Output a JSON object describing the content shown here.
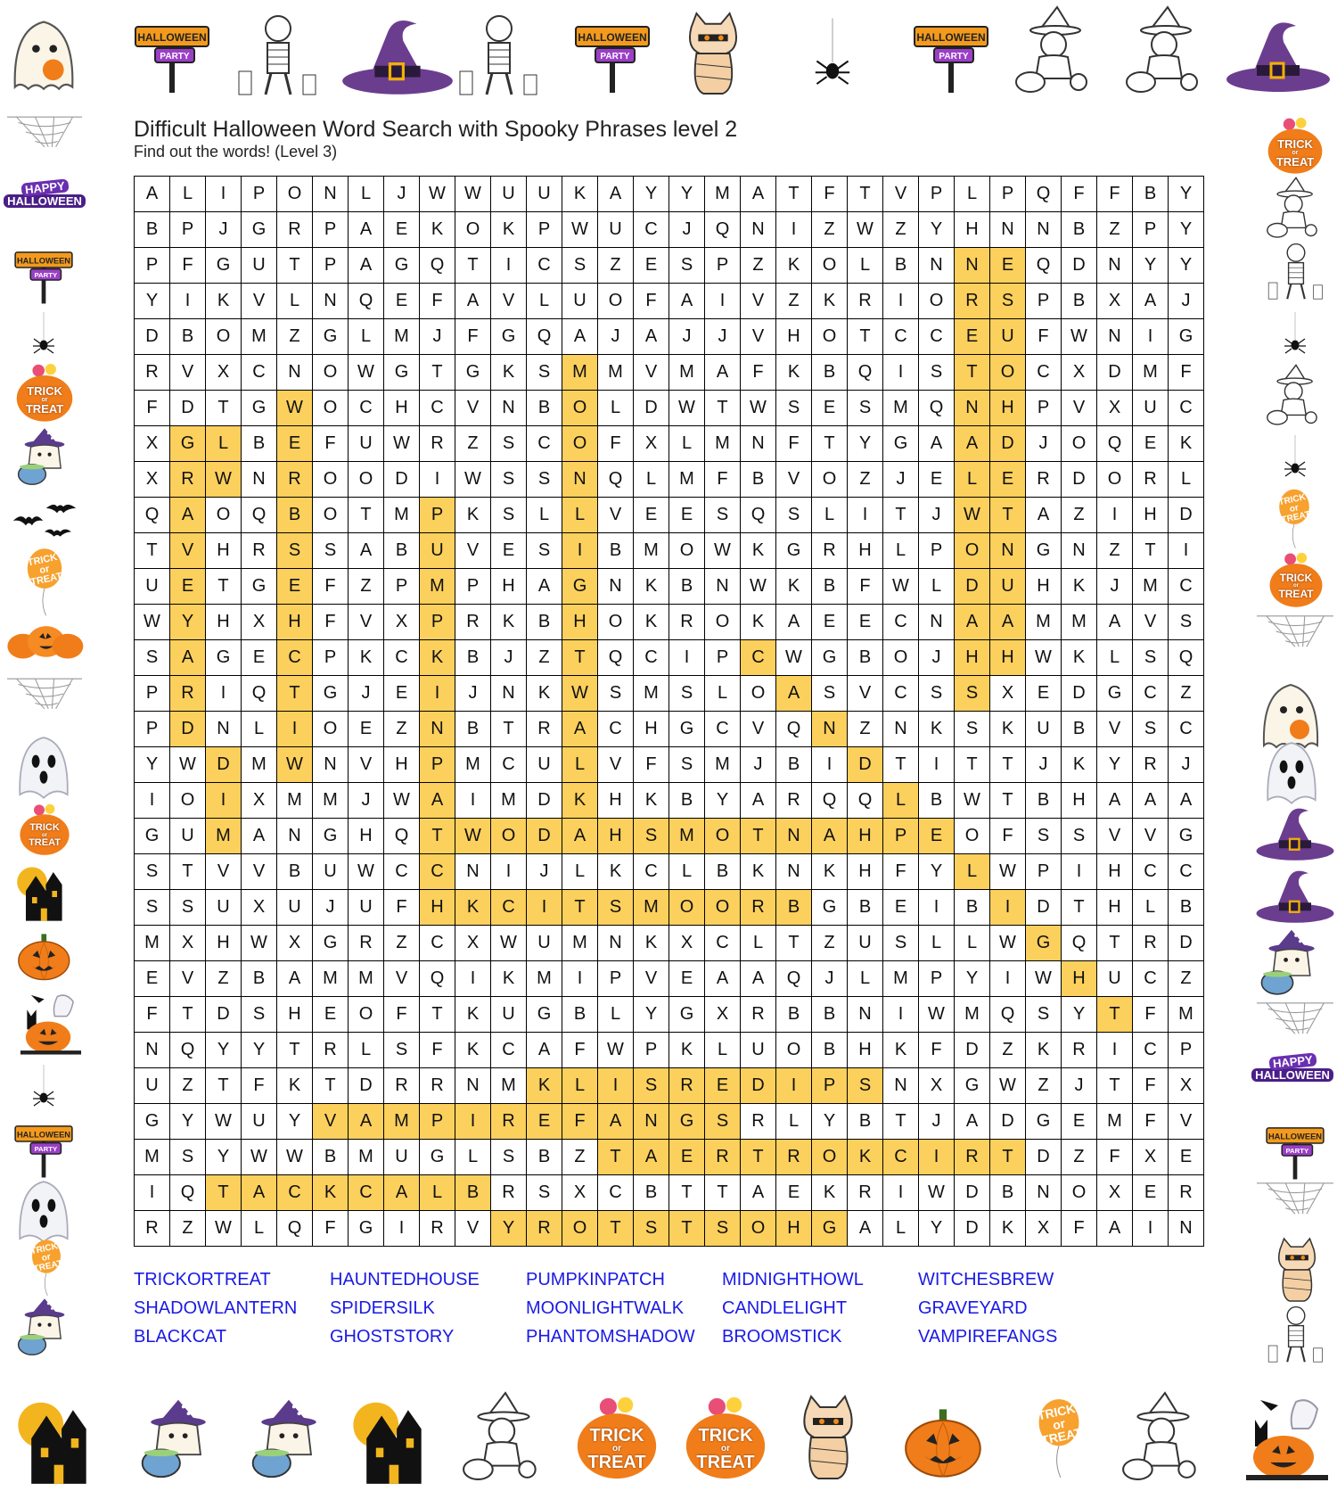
{
  "header": {
    "title": "Difficult Halloween Word Search with Spooky Phrases level 2",
    "subtitle": "Find out the words! (Level 3)"
  },
  "puzzle": {
    "rows": [
      "ALIPONLJWWUUKAYYMATFTVPLPQFFBY",
      "BPJGRPAEKOKPWUCJQNIZWZYHNNBZPY",
      "PFGUTPAGQTICSZESPZKOLBNNEQDNYY",
      "YIKVLNQEFAVLUOFAIVZKRIORSPBXAJ",
      "DBOMZGLMJFGQAJAJJVHOTCCEUFWNIG",
      "RVXCNOWGTGKSMMVMAFKBQISTOCXDMF",
      "FDTGWOCHCVNBOLDWTWSESMQNHPVXUC",
      "XGLBEFUWRZSCOFXLMNFTYGAADJOQEK",
      "XRWNROODIWSSNQLMFBVOZJELERDORL",
      "QAOQBOTMPKSLLVEESQSLITJWTAZIHD",
      "TVHRSSABUVESIBMOWKGRHLPONGNZTI",
      "UETGEFZPMPHAGNKBNWKBFWLDUHKJMC",
      "WYHXHFVXPRKBHOKROKAEECNAAMMAVS",
      "SAGECPKCKBJZTQCIPCWGBOJHHWKLSQ",
      "PRIQTGJEIJNKWSMSLOASVCSSXEDGCZ",
      "PDNLIOEZNBTRACHGCVQNZNKSKUBVSC",
      "YWDMWNVHPMCULVFSMJBIDTITTJKYRJ",
      "IOIXMMJWAIMDKHKBYARQQLBWTBHAAA",
      "GUMANGHQTWODAHSMOTNAHPEOFSSVVG",
      "STVVBUWCCNIJLKCLBKNKHFYLWPIHCC",
      "SSUXUJUFHKCITSMOORBGBEIBIDTHLB",
      "MXHWXGRZCXWUMNKXCLTZUSLLWGQTRD",
      "EVZBAMMVQIKMIPVEAAQJLMPYIWHUCZ",
      "FTDSHEOFTKUGBLYGXRBBNIWMQSYTFM",
      "NQYYTRLSFKCAFWPKLUOBHKFDZKRICP",
      "UZTFKTDRRNMKLISREDIPSNXGWZJTFX",
      "GYWUYVAMPIREFANGSRLYBTJADGEMFV",
      "MSYWWBMUGLSBZTAERTROKCIRTDZFXE",
      "IQTACKCALBRSXCBTTAEKRIWDBNOXER",
      "RZWLQFGIRVYROTSTSOHGALYDKXFAIN"
    ],
    "highlighted": [
      "2-23",
      "2-24",
      "3-23",
      "3-24",
      "4-23",
      "4-24",
      "5-23",
      "5-24",
      "6-23",
      "6-24",
      "7-23",
      "7-24",
      "8-23",
      "8-24",
      "9-23",
      "9-24",
      "10-23",
      "10-24",
      "11-23",
      "11-24",
      "12-23",
      "12-24",
      "13-23",
      "13-24",
      "14-23",
      "5-12",
      "6-12",
      "7-12",
      "8-12",
      "9-12",
      "10-12",
      "11-12",
      "12-12",
      "13-12",
      "14-12",
      "15-12",
      "16-12",
      "17-12",
      "6-4",
      "7-4",
      "8-4",
      "9-4",
      "10-4",
      "11-4",
      "12-4",
      "13-4",
      "14-4",
      "15-4",
      "16-4",
      "7-1",
      "8-1",
      "9-1",
      "10-1",
      "11-1",
      "12-1",
      "13-1",
      "14-1",
      "15-1",
      "16-2",
      "17-2",
      "18-2",
      "7-2",
      "8-2",
      "9-8",
      "10-8",
      "11-8",
      "12-8",
      "13-8",
      "14-8",
      "15-8",
      "16-8",
      "17-8",
      "18-8",
      "19-8",
      "20-8",
      "13-17",
      "14-18",
      "15-19",
      "16-20",
      "17-21",
      "18-22",
      "19-23",
      "20-24",
      "21-25",
      "22-26",
      "23-27",
      "18-9",
      "18-10",
      "18-11",
      "18-12",
      "18-13",
      "18-14",
      "18-15",
      "18-16",
      "18-17",
      "18-18",
      "18-19",
      "18-20",
      "18-21",
      "18-22",
      "20-9",
      "20-10",
      "20-11",
      "20-12",
      "20-13",
      "20-14",
      "20-15",
      "20-16",
      "20-17",
      "20-18",
      "25-11",
      "25-12",
      "25-13",
      "25-14",
      "25-15",
      "25-16",
      "25-17",
      "25-18",
      "25-19",
      "25-20",
      "26-5",
      "26-6",
      "26-7",
      "26-8",
      "26-9",
      "26-10",
      "26-11",
      "26-12",
      "26-13",
      "26-14",
      "26-15",
      "26-16",
      "27-13",
      "27-14",
      "27-15",
      "27-16",
      "27-17",
      "27-18",
      "27-19",
      "27-20",
      "27-21",
      "27-22",
      "27-23",
      "27-24",
      "28-2",
      "28-3",
      "28-4",
      "28-5",
      "28-6",
      "28-7",
      "28-8",
      "28-9",
      "29-10",
      "29-11",
      "29-12",
      "29-13",
      "29-14",
      "29-15",
      "29-16",
      "29-17",
      "29-18",
      "29-19"
    ]
  },
  "word_list": [
    "TRICKORTREAT",
    "HAUNTEDHOUSE",
    "PUMPKINPATCH",
    "MIDNIGHTHOWL",
    "WITCHESBREW",
    "SHADOWLANTERN",
    "SPIDERSILK",
    "MOONLIGHTWALK",
    "CANDLELIGHT",
    "GRAVEYARD",
    "BLACKCAT",
    "GHOSTSTORY",
    "PHANTOMSHADOW",
    "BROOMSTICK",
    "VAMPIREFANGS"
  ],
  "decor": {
    "sign_top": "HALLOWEEN",
    "sign_bottom": "PARTY",
    "trick": "TRICK",
    "or": "or",
    "treat": "TREAT",
    "happy": "HAPPY",
    "halloween": "HALLOWEEN"
  },
  "colors": {
    "highlight": "#fcd05c",
    "word_list": "#1a1ae6",
    "witch_hat": "#6b3d8f",
    "pumpkin": "#f07d1a"
  }
}
